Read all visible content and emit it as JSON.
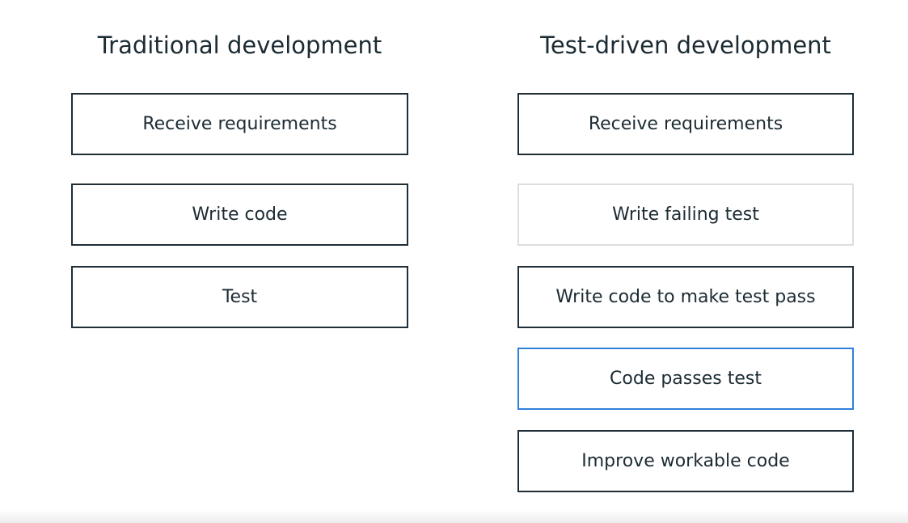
{
  "diagram": {
    "left_column": {
      "title": "Traditional development",
      "steps": [
        {
          "label": "Receive requirements",
          "state": "normal"
        },
        {
          "label": "Write code",
          "state": "normal"
        },
        {
          "label": "Test",
          "state": "normal"
        }
      ]
    },
    "right_column": {
      "title": "Test-driven development",
      "steps": [
        {
          "label": "Receive requirements",
          "state": "normal"
        },
        {
          "label": "Write failing test",
          "state": "faded"
        },
        {
          "label": "Write code to make test pass",
          "state": "normal"
        },
        {
          "label": "Code passes test",
          "state": "highlighted"
        },
        {
          "label": "Improve workable code",
          "state": "normal"
        }
      ]
    }
  },
  "colors": {
    "border_default": "#1f2d36",
    "border_faded": "#dedede",
    "border_highlight": "#2e80d9",
    "text": "#1c2b33",
    "background": "#ffffff"
  }
}
